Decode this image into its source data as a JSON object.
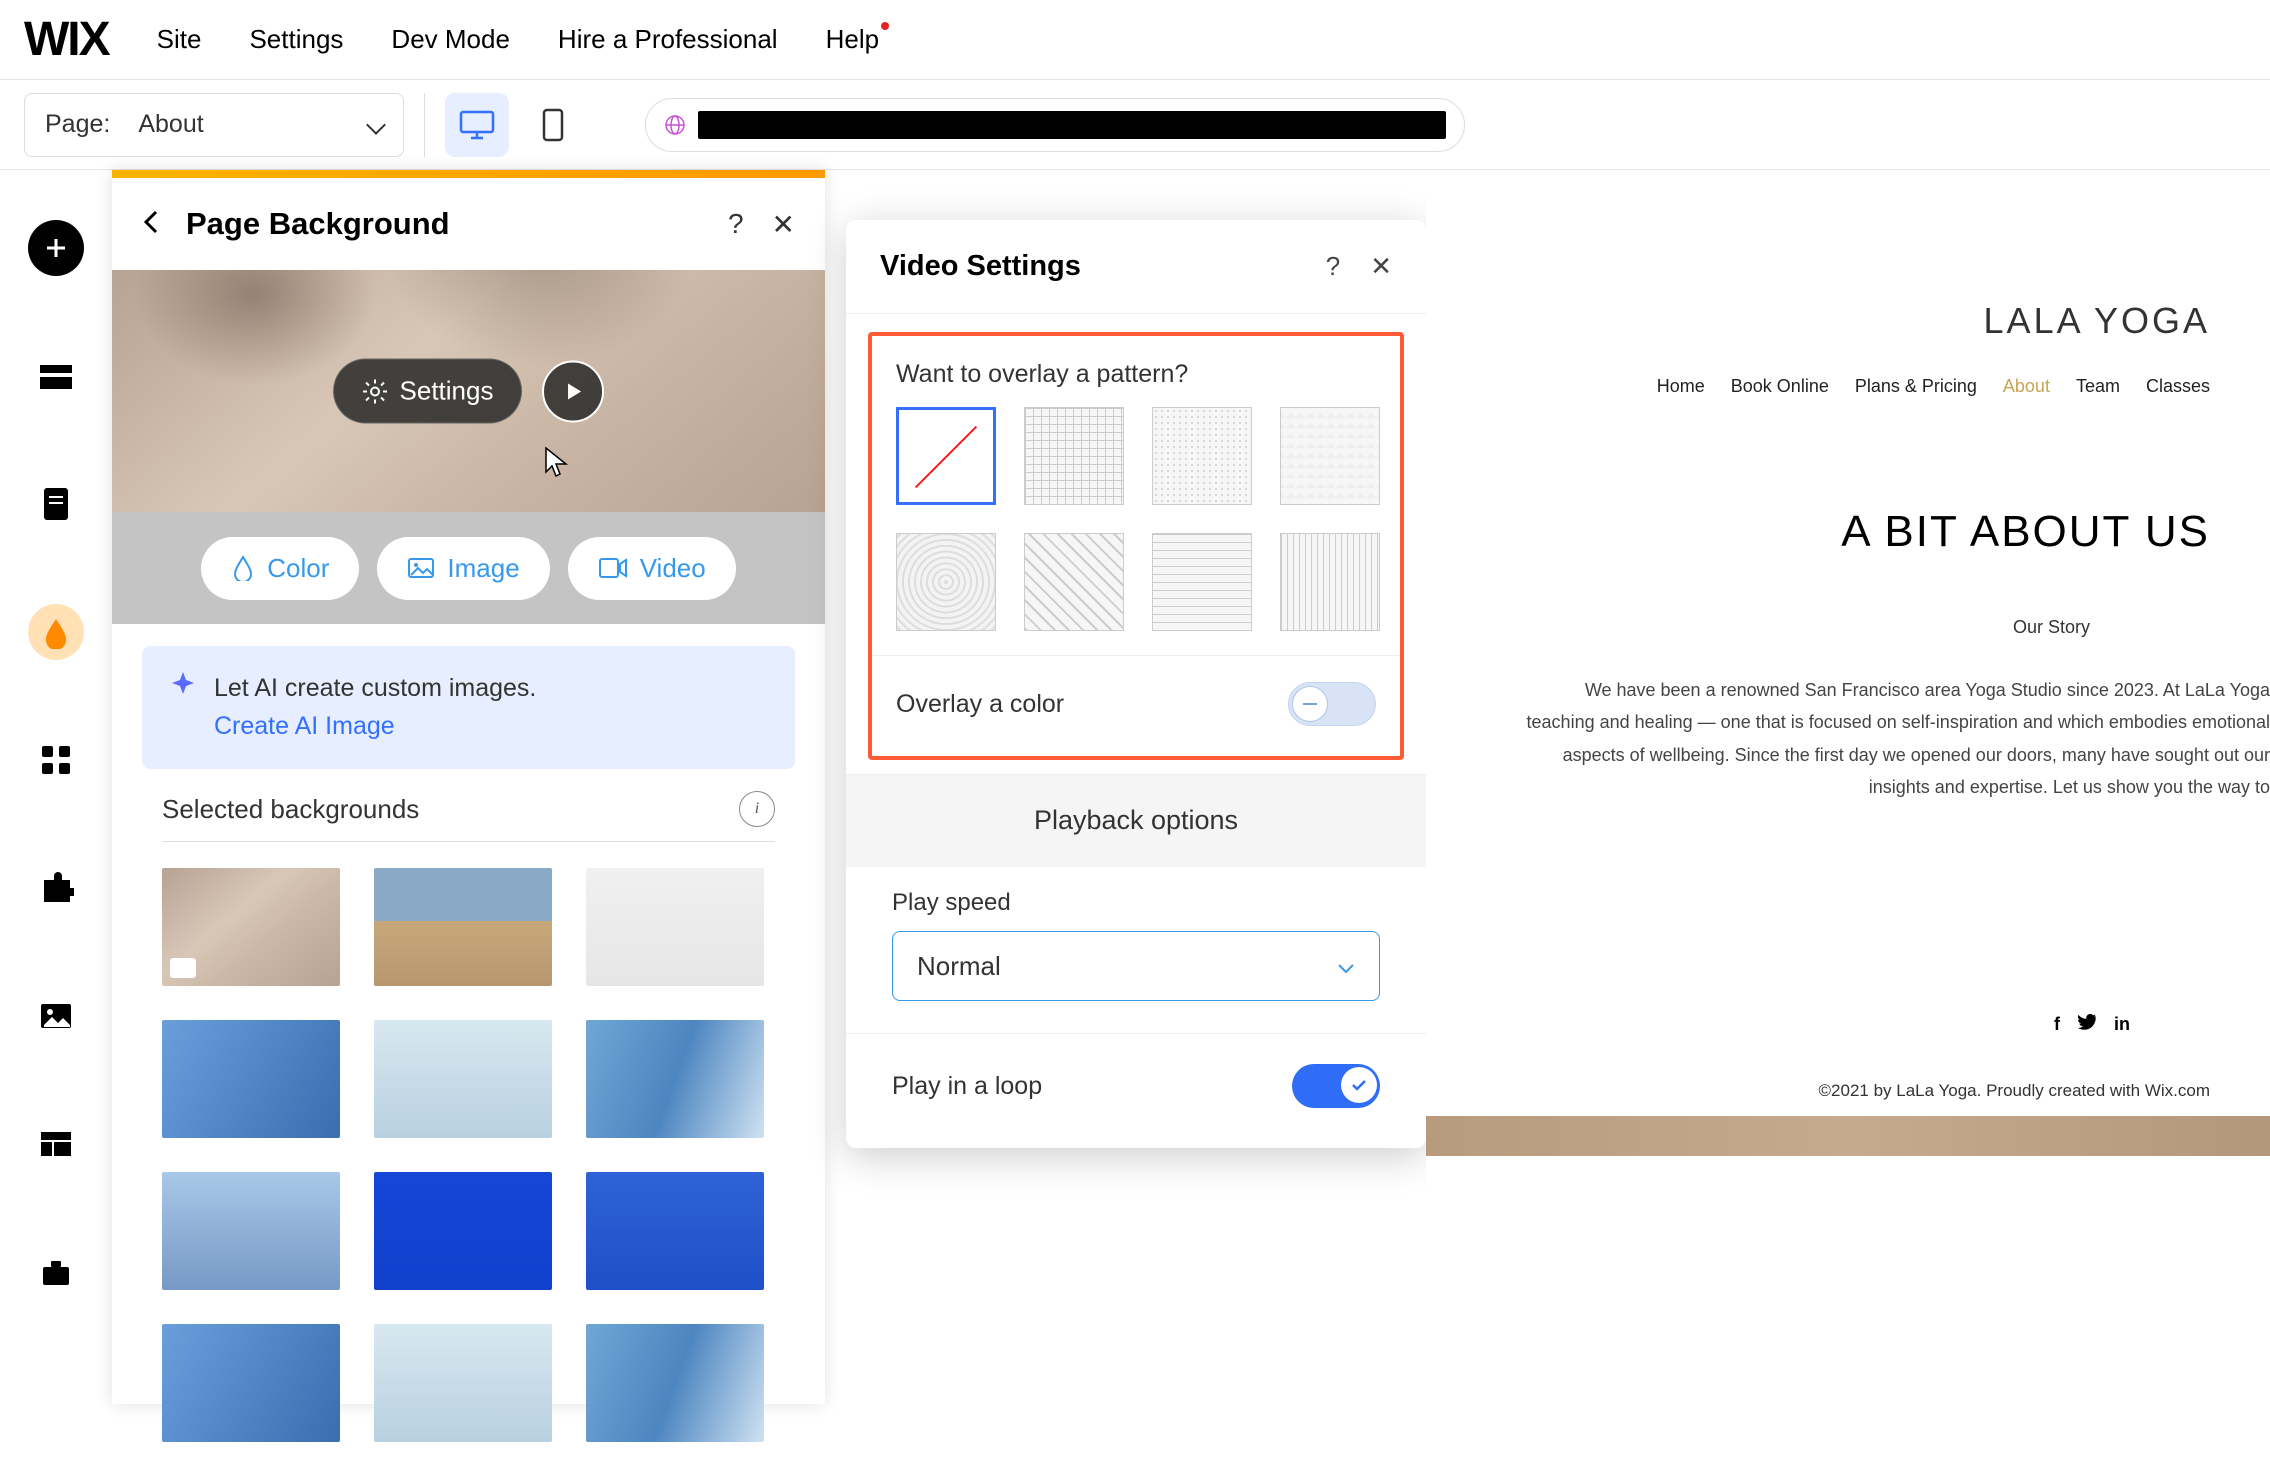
{
  "logo": "WIX",
  "topmenu": [
    "Site",
    "Settings",
    "Dev Mode",
    "Hire a Professional",
    "Help"
  ],
  "page_selector": {
    "label": "Page:",
    "value": "About"
  },
  "panel": {
    "title": "Page Background",
    "settings_btn": "Settings",
    "tabs": {
      "color": "Color",
      "image": "Image",
      "video": "Video"
    },
    "ai_line": "Let AI create custom images.",
    "ai_link": "Create AI Image",
    "selected_hdr": "Selected backgrounds"
  },
  "video_settings": {
    "title": "Video Settings",
    "overlay_q": "Want to overlay a pattern?",
    "overlay_color": "Overlay a color",
    "playback_title": "Playback options",
    "play_speed_label": "Play speed",
    "play_speed_value": "Normal",
    "loop_label": "Play in a loop"
  },
  "site": {
    "brand": "LALA YOGA",
    "nav": [
      "Home",
      "Book Online",
      "Plans & Pricing",
      "About",
      "Team",
      "Classes"
    ],
    "h1": "A BIT ABOUT US",
    "sub": "Our Story",
    "body": "We have been a renowned San Francisco area Yoga Studio since 2023. At LaLa Yoga teaching and healing — one that is focused on self-inspiration and which embodies emotional aspects of wellbeing. Since the first day we opened our doors, many have sought out our insights and expertise. Let us show you the way to",
    "footer": "©2021 by LaLa Yoga. Proudly created with Wix.com"
  }
}
